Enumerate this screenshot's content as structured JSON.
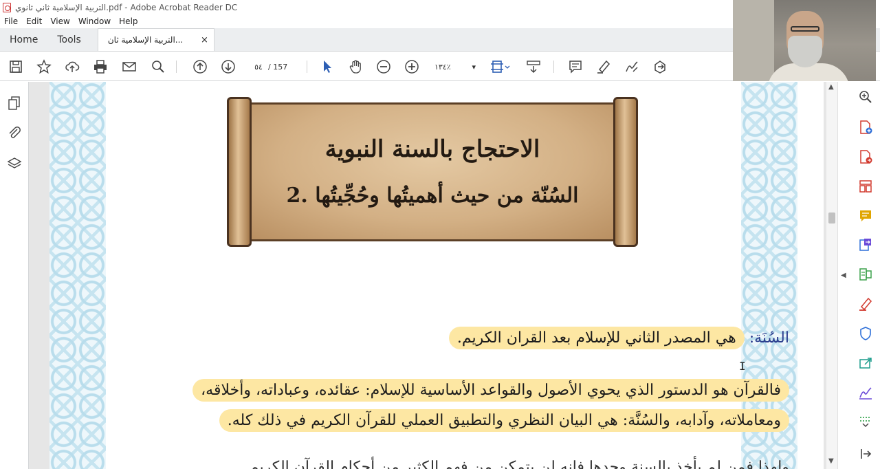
{
  "window": {
    "title": "التربية الإسلامية ثاني ثانوي.pdf - Adobe Acrobat Reader DC"
  },
  "menu": [
    "File",
    "Edit",
    "View",
    "Window",
    "Help"
  ],
  "tabs": {
    "home": "Home",
    "tools": "Tools",
    "document": "التربية الإسلامية ثان...",
    "close_glyph": "×"
  },
  "toolbar": {
    "page_current": "٥٤",
    "page_total": "/ 157",
    "zoom": "١٣٤٪",
    "zoom_caret": "▾"
  },
  "document": {
    "banner_title": "الاحتجاج بالسنة النبوية",
    "banner_subtitle": "2. السُنّة من حيث أهميتُها وحُجِّيتُها",
    "para1_term": "السُنَة:",
    "para1_text": "هي المصدر الثاني للإسلام بعد القران الكريم.",
    "para2_line1": "فالقرآن هو الدستور الذي يحوي الأصول والقواعد الأساسية للإسلام: عقائده، وعباداته، وأخلاقه،",
    "para2_line2": "ومعاملاته، وآدابه، والسُنَّة: هي البيان النظري والتطبيق العملي للقرآن الكريم في ذلك كله.",
    "para3_partial": "ولهذا فمن لم يأخذ بالسنة وحدها فإنه لن يتمكن من فهم الكثير من أحكام القرآن الكريم"
  },
  "cursor_glyph": "I",
  "scrollbar": {
    "up": "▲",
    "down": "▼"
  },
  "pane_arrows": {
    "left": "◀",
    "right": "◀"
  },
  "colors": {
    "accent_blue": "#2d5fb4",
    "highlight": "#fde7a3",
    "pdf_red": "#d23a2f",
    "tool_icons": [
      "#2d6fd8",
      "#d23a2f",
      "#d23a2f",
      "#d23a2f",
      "#e0a500",
      "#2d6fd8",
      "#3aa04a",
      "#d23a2f",
      "#2d6fd8",
      "#1a9c8c",
      "#6b4bd8",
      "#1e9a3a"
    ]
  },
  "icons": {
    "toolbar": [
      "save-icon",
      "bookmark-star-icon",
      "upload-cloud-icon",
      "print-icon",
      "email-icon",
      "zoom-search-icon",
      "page-up-icon",
      "page-down-icon",
      "select-arrow-icon",
      "hand-pan-icon",
      "zoom-out-icon",
      "zoom-in-icon",
      "fit-page-icon",
      "scroll-mode-icon",
      "comment-icon",
      "highlight-pen-icon",
      "sign-icon",
      "more-tools-icon"
    ],
    "left": [
      "pages-icon",
      "attachments-icon",
      "layers-icon"
    ],
    "right": [
      "search-zoom-icon",
      "create-pdf-icon",
      "export-pdf-icon",
      "organize-pages-icon",
      "comment-tool-icon",
      "send-for-review-icon",
      "edit-pdf-icon",
      "fill-sign-icon",
      "protect-icon",
      "share-icon",
      "signature-icon",
      "more-tool-icon",
      "expand-panel-icon"
    ]
  }
}
